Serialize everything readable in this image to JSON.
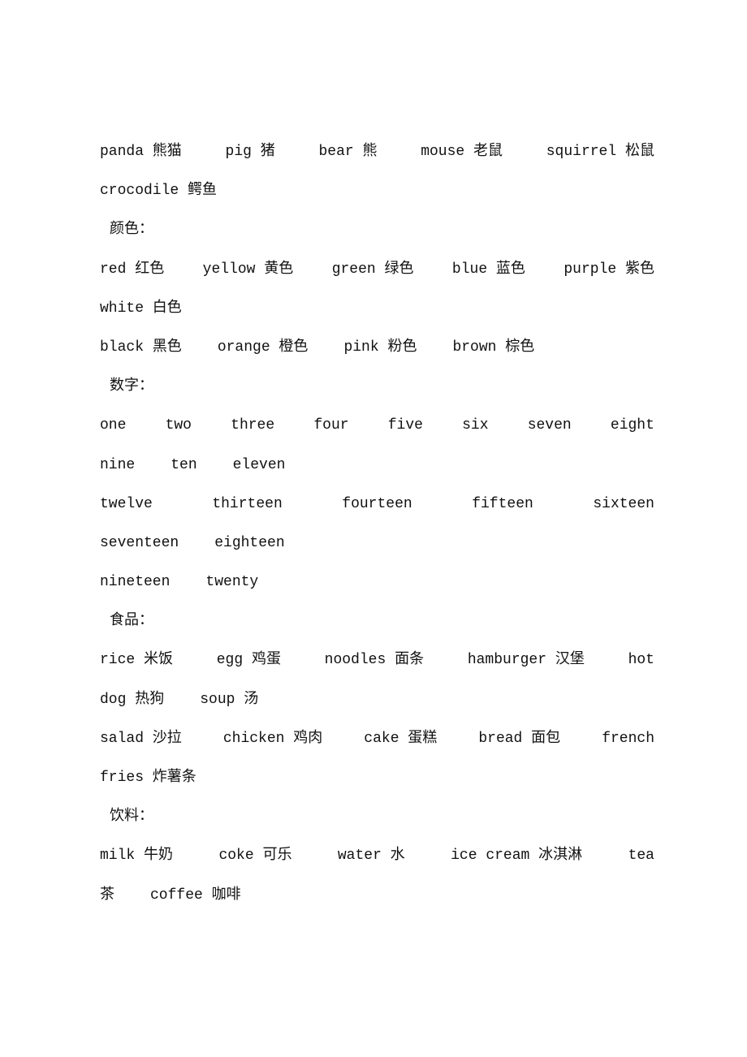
{
  "sections": [
    {
      "heading": "",
      "paragraphs": [
        [
          [
            "panda 熊猫",
            "pig 猪",
            "bear 熊",
            "mouse 老鼠",
            "squirrel 松鼠"
          ],
          [
            "crocodile 鳄鱼"
          ]
        ]
      ]
    },
    {
      "heading": "颜色：",
      "paragraphs": [
        [
          [
            "red 红色",
            "yellow 黄色",
            "green 绿色",
            "blue 蓝色",
            "purple 紫色"
          ],
          [
            "white 白色"
          ]
        ],
        [
          [
            "black 黑色",
            "orange 橙色",
            "pink 粉色",
            "brown 棕色"
          ]
        ]
      ]
    },
    {
      "heading": "数字：",
      "paragraphs": [
        [
          [
            "one",
            "two",
            "three",
            "four",
            "five",
            "six",
            "seven",
            "eight"
          ],
          [
            "nine",
            "ten",
            "eleven"
          ]
        ],
        [
          [
            "twelve",
            "thirteen",
            "fourteen",
            "fifteen",
            "sixteen"
          ],
          [
            "seventeen",
            "eighteen"
          ]
        ],
        [
          [
            "nineteen",
            "twenty"
          ]
        ]
      ]
    },
    {
      "heading": "食品：",
      "paragraphs": [
        [
          [
            "rice 米饭",
            "egg 鸡蛋",
            "noodles 面条",
            "hamburger 汉堡",
            "hot"
          ],
          [
            "dog 热狗",
            "soup 汤"
          ]
        ],
        [
          [
            "salad 沙拉",
            "chicken 鸡肉",
            "cake 蛋糕",
            "bread 面包",
            "french"
          ],
          [
            "fries 炸薯条"
          ]
        ]
      ]
    },
    {
      "heading": "饮料：",
      "paragraphs": [
        [
          [
            "milk 牛奶",
            "coke 可乐",
            "water 水",
            "ice cream 冰淇淋",
            "tea"
          ],
          [
            "茶",
            "coffee 咖啡"
          ]
        ]
      ]
    }
  ]
}
